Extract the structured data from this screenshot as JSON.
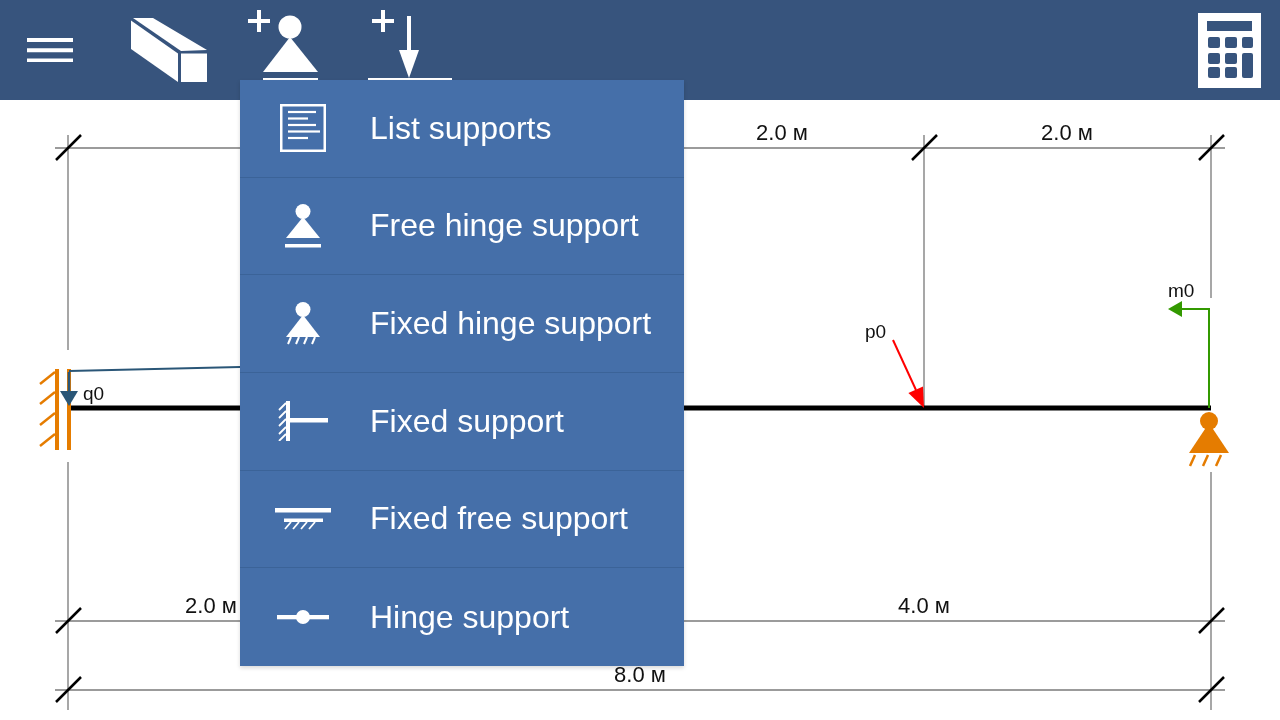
{
  "support_menu": {
    "items": [
      {
        "label": "List supports"
      },
      {
        "label": "Free hinge support"
      },
      {
        "label": "Fixed hinge support"
      },
      {
        "label": "Fixed support"
      },
      {
        "label": "Fixed free support"
      },
      {
        "label": "Hinge support"
      }
    ]
  },
  "dimension_lines": [
    {
      "segments": [
        "2.0 м",
        "2.0 м"
      ]
    },
    {
      "segments": [
        "2.0 м",
        "4.0 м"
      ]
    },
    {
      "segments": [
        "8.0 м"
      ]
    }
  ],
  "loads": [
    {
      "kind": "distributed",
      "label": "q0",
      "color": "#2a5677"
    },
    {
      "kind": "point",
      "label": "p0",
      "color": "#ff0000"
    },
    {
      "kind": "moment",
      "label": "m0",
      "color": "#339900"
    }
  ],
  "supports": [
    {
      "kind": "fixed"
    },
    {
      "kind": "fixed_hinge"
    }
  ]
}
